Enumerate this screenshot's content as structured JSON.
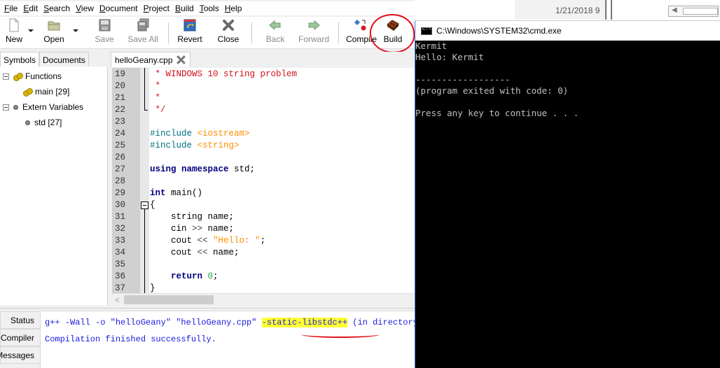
{
  "menubar": {
    "items": [
      {
        "mnemonic": "F",
        "rest": "ile"
      },
      {
        "mnemonic": "E",
        "rest": "dit"
      },
      {
        "mnemonic": "S",
        "rest": "earch"
      },
      {
        "mnemonic": "V",
        "rest": "iew"
      },
      {
        "mnemonic": "D",
        "rest": "ocument"
      },
      {
        "mnemonic": "P",
        "rest": "roject"
      },
      {
        "mnemonic": "B",
        "rest": "uild"
      },
      {
        "mnemonic": "T",
        "rest": "ools"
      },
      {
        "mnemonic": "H",
        "rest": "elp"
      }
    ]
  },
  "toolbar": {
    "new": "New",
    "open": "Open",
    "save": "Save",
    "save_all": "Save All",
    "revert": "Revert",
    "close": "Close",
    "back": "Back",
    "forward": "Forward",
    "compile": "Compile",
    "build": "Build"
  },
  "sidebar": {
    "tabs": [
      "Symbols",
      "Documents"
    ],
    "tree": {
      "functions_label": "Functions",
      "functions": [
        "main [29]"
      ],
      "extern_label": "Extern Variables",
      "externs": [
        "std [27]"
      ]
    }
  },
  "editor": {
    "tab_label": "helloGeany.cpp",
    "lines": [
      {
        "n": "19",
        "parts": [
          {
            "c": "c-comment",
            "t": " * WINDOWS 10 string problem"
          }
        ]
      },
      {
        "n": "20",
        "parts": [
          {
            "c": "c-comment",
            "t": " *"
          }
        ]
      },
      {
        "n": "21",
        "parts": [
          {
            "c": "c-comment",
            "t": " *"
          }
        ]
      },
      {
        "n": "22",
        "parts": [
          {
            "c": "c-comment",
            "t": " */"
          }
        ]
      },
      {
        "n": "23",
        "parts": []
      },
      {
        "n": "24",
        "parts": [
          {
            "c": "c-pre",
            "t": "#include "
          },
          {
            "c": "c-str",
            "t": "<iostream>"
          }
        ]
      },
      {
        "n": "25",
        "parts": [
          {
            "c": "c-pre",
            "t": "#include "
          },
          {
            "c": "c-str",
            "t": "<string>"
          }
        ]
      },
      {
        "n": "26",
        "parts": []
      },
      {
        "n": "27",
        "parts": [
          {
            "c": "c-kw",
            "t": "using namespace "
          },
          {
            "c": "c-norm",
            "t": "std;"
          }
        ]
      },
      {
        "n": "28",
        "parts": []
      },
      {
        "n": "29",
        "parts": [
          {
            "c": "c-kw",
            "t": "int "
          },
          {
            "c": "c-norm",
            "t": "main()"
          }
        ]
      },
      {
        "n": "30",
        "parts": [
          {
            "c": "c-norm",
            "t": "{"
          }
        ]
      },
      {
        "n": "31",
        "parts": [
          {
            "c": "c-norm",
            "t": "    string name;"
          }
        ]
      },
      {
        "n": "32",
        "parts": [
          {
            "c": "c-norm",
            "t": "    cin "
          },
          {
            "c": "c-op",
            "t": ">>"
          },
          {
            "c": "c-norm",
            "t": " name;"
          }
        ]
      },
      {
        "n": "33",
        "parts": [
          {
            "c": "c-norm",
            "t": "    cout "
          },
          {
            "c": "c-op",
            "t": "<<"
          },
          {
            "c": "c-norm",
            "t": " "
          },
          {
            "c": "c-str",
            "t": "\"Hello: \""
          },
          {
            "c": "c-norm",
            "t": ";"
          }
        ]
      },
      {
        "n": "34",
        "parts": [
          {
            "c": "c-norm",
            "t": "    cout "
          },
          {
            "c": "c-op",
            "t": "<<"
          },
          {
            "c": "c-norm",
            "t": " name;"
          }
        ]
      },
      {
        "n": "35",
        "parts": []
      },
      {
        "n": "36",
        "parts": [
          {
            "c": "c-kw",
            "t": "    return "
          },
          {
            "c": "c-num",
            "t": "0"
          },
          {
            "c": "c-norm",
            "t": ";"
          }
        ]
      },
      {
        "n": "37",
        "parts": [
          {
            "c": "c-norm",
            "t": "}"
          }
        ]
      }
    ]
  },
  "messages": {
    "tabs": [
      "Status",
      "Compiler",
      "Messages"
    ],
    "line1_pre": "g++ -Wall -o \"helloGeany\" \"helloGeany.cpp\" ",
    "line1_highlight": "-static-libstdc++",
    "line1_post": " (in directory:",
    "line2": "Compilation finished successfully."
  },
  "background_window": {
    "date_text": "1/21/2018 9"
  },
  "cmd": {
    "title": "C:\\Windows\\SYSTEM32\\cmd.exe",
    "lines": [
      "Kermit",
      "Hello: Kermit",
      "",
      "------------------",
      "(program exited with code: 0)",
      "",
      "Press any key to continue . . ."
    ]
  },
  "colors": {
    "annotation_red": "#e0101a",
    "highlight_yellow": "#ffff33",
    "compiler_text_blue": "#1a1ae0"
  }
}
